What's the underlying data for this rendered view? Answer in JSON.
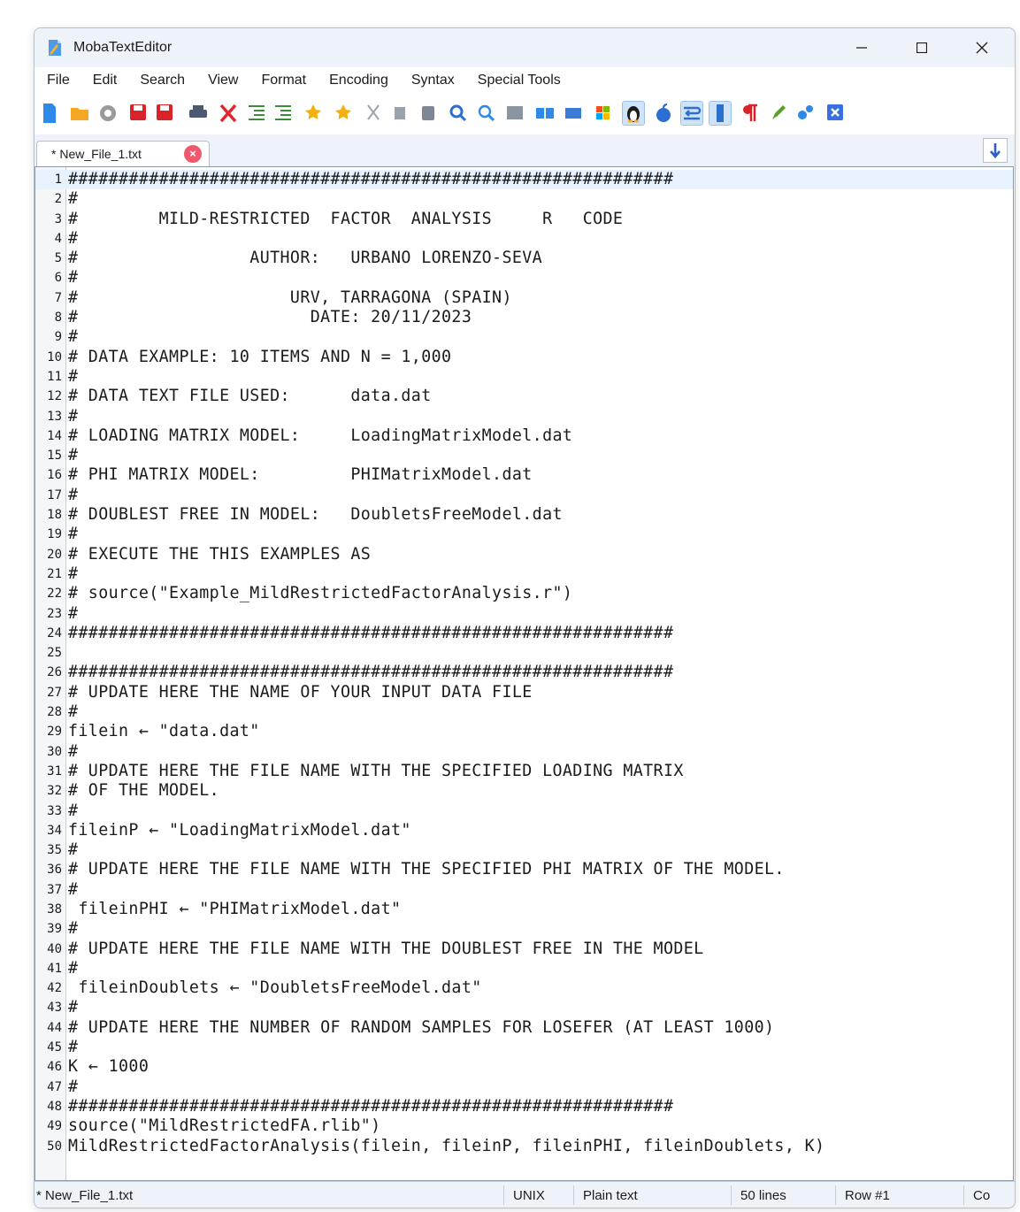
{
  "window": {
    "title": "MobaTextEditor"
  },
  "menu": [
    "File",
    "Edit",
    "Search",
    "View",
    "Format",
    "Encoding",
    "Syntax",
    "Special Tools"
  ],
  "toolbar_icons": [
    {
      "name": "new-file-icon",
      "color": "#2d8ae8"
    },
    {
      "name": "open-folder-icon",
      "color": "#f5a623"
    },
    {
      "name": "reload-icon",
      "color": "#9a9a9a"
    },
    {
      "name": "save-icon",
      "color": "#d8232a"
    },
    {
      "name": "save-as-icon",
      "color": "#d8232a"
    },
    {
      "name": "print-icon",
      "color": "#4a5a70"
    },
    {
      "name": "close-file-icon",
      "color": "#e0262e"
    },
    {
      "name": "indent-icon",
      "color": "#3a8e3a"
    },
    {
      "name": "outdent-icon",
      "color": "#3a8e3a"
    },
    {
      "name": "bookmark-add-icon",
      "color": "#f2b10f"
    },
    {
      "name": "bookmark-icon",
      "color": "#f2b10f"
    },
    {
      "name": "cut-icon",
      "color": "#9aa3ad"
    },
    {
      "name": "copy-icon",
      "color": "#9aa3ad"
    },
    {
      "name": "paste-icon",
      "color": "#7d8894"
    },
    {
      "name": "find-icon",
      "color": "#2d6fd0"
    },
    {
      "name": "find-replace-icon",
      "color": "#2d8ae8"
    },
    {
      "name": "fullscreen-icon",
      "color": "#8a95a2"
    },
    {
      "name": "compare-icon",
      "color": "#2d8ae8"
    },
    {
      "name": "merge-icon",
      "color": "#3a7bd5"
    },
    {
      "name": "windows-lineend-icon",
      "color": "#f25022"
    },
    {
      "name": "linux-lineend-icon",
      "color": "#1b1b1b"
    },
    {
      "name": "mac-lineend-icon",
      "color": "#2d6fd0"
    },
    {
      "name": "word-wrap-icon",
      "color": "#2d6fd0"
    },
    {
      "name": "column-icon",
      "color": "#2d6fd0"
    },
    {
      "name": "pilcrow-icon",
      "color": "#d8232a"
    },
    {
      "name": "highlight-icon",
      "color": "#5aa02c"
    },
    {
      "name": "settings-icon",
      "color": "#2d8ae8"
    },
    {
      "name": "exit-icon",
      "color": "#3a6fe0"
    }
  ],
  "tab": {
    "label": "* New_File_1.txt",
    "close": "×"
  },
  "editor": {
    "current_line": 1,
    "lines": [
      "############################################################",
      "#",
      "#        MILD-RESTRICTED  FACTOR  ANALYSIS     R   CODE",
      "#",
      "#                 AUTHOR:   URBANO LORENZO-SEVA",
      "#",
      "#                     URV, TARRAGONA (SPAIN)",
      "#                       DATE: 20/11/2023",
      "#",
      "# DATA EXAMPLE: 10 ITEMS AND N = 1,000",
      "#",
      "# DATA TEXT FILE USED:      data.dat",
      "#",
      "# LOADING MATRIX MODEL:     LoadingMatrixModel.dat",
      "#",
      "# PHI MATRIX MODEL:         PHIMatrixModel.dat",
      "#",
      "# DOUBLEST FREE IN MODEL:   DoubletsFreeModel.dat",
      "#",
      "# EXECUTE THE THIS EXAMPLES AS",
      "#",
      "# source(\"Example_MildRestrictedFactorAnalysis.r\")",
      "#",
      "############################################################",
      "",
      "############################################################",
      "# UPDATE HERE THE NAME OF YOUR INPUT DATA FILE",
      "#",
      "filein ← \"data.dat\"",
      "#",
      "# UPDATE HERE THE FILE NAME WITH THE SPECIFIED LOADING MATRIX",
      "# OF THE MODEL.",
      "#",
      "fileinP ← \"LoadingMatrixModel.dat\"",
      "#",
      "# UPDATE HERE THE FILE NAME WITH THE SPECIFIED PHI MATRIX OF THE MODEL.",
      "#",
      " fileinPHI ← \"PHIMatrixModel.dat\"",
      "#",
      "# UPDATE HERE THE FILE NAME WITH THE DOUBLEST FREE IN THE MODEL",
      "#",
      " fileinDoublets ← \"DoubletsFreeModel.dat\"",
      "#",
      "# UPDATE HERE THE NUMBER OF RANDOM SAMPLES FOR LOSEFER (AT LEAST 1000)",
      "#",
      "K ← 1000",
      "#",
      "############################################################",
      "source(\"MildRestrictedFA.rlib\")",
      "MildRestrictedFactorAnalysis(filein, fileinP, fileinPHI, fileinDoublets, K)"
    ]
  },
  "status": {
    "file": "* New_File_1.txt",
    "line_ending": "UNIX",
    "syntax": "Plain text",
    "line_count": "50 lines",
    "row": "Row #1",
    "col": "Co"
  }
}
